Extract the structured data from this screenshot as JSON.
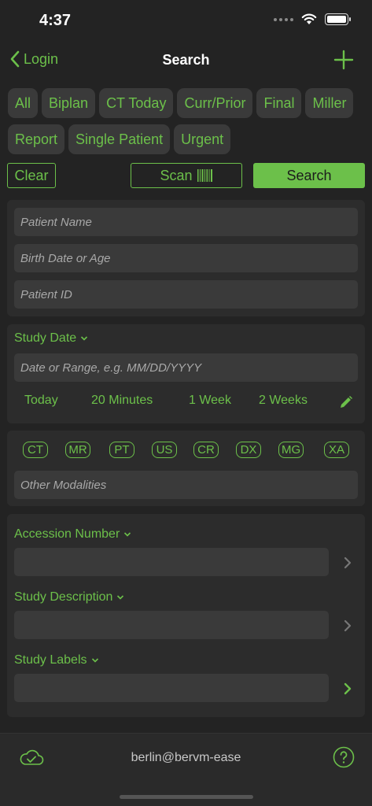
{
  "status_bar": {
    "time": "4:37"
  },
  "nav": {
    "back_label": "Login",
    "title": "Search"
  },
  "filters": {
    "row1": [
      "All",
      "Biplan",
      "CT Today",
      "Curr/Prior",
      "Final",
      "Miller"
    ],
    "row2": [
      "Report",
      "Single Patient",
      "Urgent"
    ]
  },
  "actions": {
    "clear": "Clear",
    "scan": "Scan",
    "search": "Search"
  },
  "patient": {
    "name_placeholder": "Patient Name",
    "birth_placeholder": "Birth Date or Age",
    "id_placeholder": "Patient ID"
  },
  "study_date": {
    "label": "Study Date",
    "placeholder": "Date or Range, e.g. MM/DD/YYYY",
    "quick": [
      "Today",
      "20 Minutes",
      "1 Week",
      "2 Weeks"
    ]
  },
  "modalities": {
    "items": [
      "CT",
      "MR",
      "PT",
      "US",
      "CR",
      "DX",
      "MG",
      "XA"
    ],
    "other_placeholder": "Other Modalities"
  },
  "details": {
    "accession_label": "Accession Number",
    "description_label": "Study Description",
    "labels_label": "Study Labels"
  },
  "footer": {
    "user": "berlin@bervm-ease"
  },
  "colors": {
    "accent": "#6cc04a",
    "background": "#232323",
    "panel": "#2c2c2c",
    "field": "#3a3a3a"
  },
  "icons": [
    "back-chevron-icon",
    "plus-icon",
    "barcode-icon",
    "pencil-icon",
    "chevron-right-icon",
    "cloud-check-icon",
    "help-icon"
  ]
}
